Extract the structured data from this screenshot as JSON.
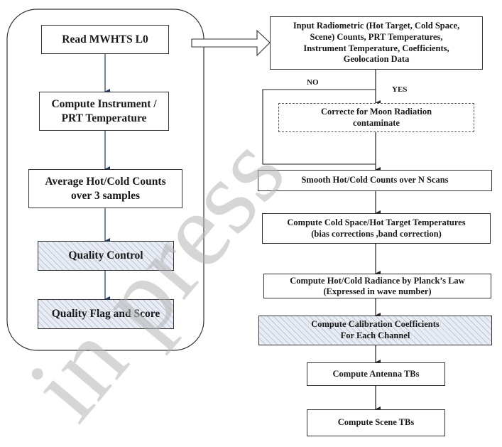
{
  "left_panel": {
    "steps": [
      {
        "id": "read",
        "lines": [
          "Read MWHTS L0"
        ],
        "style": "plain"
      },
      {
        "id": "instr",
        "lines": [
          "Compute Instrument /",
          "PRT Temperature"
        ],
        "style": "plain"
      },
      {
        "id": "avg",
        "lines": [
          "Average Hot/Cold Counts",
          "over 3 samples"
        ],
        "style": "plain"
      },
      {
        "id": "qc",
        "lines": [
          "Quality Control"
        ],
        "style": "hatched"
      },
      {
        "id": "qf",
        "lines": [
          "Quality Flag and Score"
        ],
        "style": "hatched"
      }
    ]
  },
  "right_panel": {
    "input": {
      "lines": [
        "Input Radiometric (Hot Target, Cold Space,",
        "Scene) Counts, PRT Temperatures,",
        "Instrument Temperature, Coefficients,",
        "Geolocation Data"
      ]
    },
    "branch_no": "NO",
    "branch_yes": "YES",
    "moon": {
      "lines": [
        "Correcte for Moon Radiation",
        "contaminate"
      ],
      "style": "dashed"
    },
    "smooth": {
      "lines": [
        "Smooth Hot/Cold Counts over  N Scans"
      ]
    },
    "coldhot": {
      "lines": [
        "Compute Cold Space/Hot Target Temperatures",
        "(bias corrections ,band correction)"
      ]
    },
    "radiance": {
      "lines": [
        "Compute  Hot/Cold Radiance by Planck’s Law",
        "(Expressed in wave number)"
      ]
    },
    "calib": {
      "lines": [
        "Compute  Calibration Coefficients",
        "For Each Channel"
      ],
      "style": "hatched"
    },
    "antenna": {
      "lines": [
        "Compute Antenna TBs"
      ]
    },
    "scene": {
      "lines": [
        "Compute  Scene TBs"
      ]
    }
  },
  "watermark": "in press",
  "colors": {
    "left_arrows": "#1f3a6e",
    "right_arrows": "#222222",
    "hatch_fill": "#e8ecf4",
    "watermark": "#c8c8c8"
  }
}
